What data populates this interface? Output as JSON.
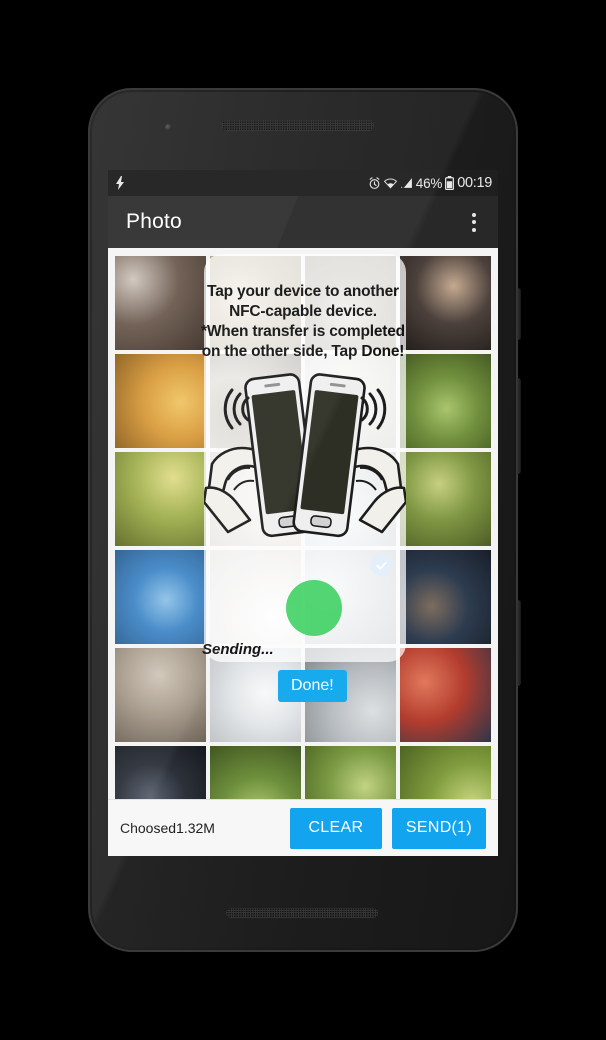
{
  "device": {
    "name": "android-phone-mockup"
  },
  "status_bar": {
    "charging_icon": "bolt-icon",
    "alarm_icon": "alarm-clock-icon",
    "wifi_icon": "wifi-icon",
    "signal_icon": "cellular-signal-icon",
    "battery_icon": "battery-icon",
    "battery_percent": "46%",
    "clock": "00:19"
  },
  "app_bar": {
    "title": "Photo",
    "overflow_icon": "overflow-menu-icon"
  },
  "nfc_overlay": {
    "line1": "Tap your device to another",
    "line2": "NFC-capable device.",
    "line3": "*When transfer is completed",
    "line4": "on the other side, Tap Done!",
    "illustration": "two-phones-tapping-nfc-illustration",
    "done_label": "Done!",
    "sending_label": "Sending...",
    "progress_color": "#2bcd53",
    "done_button_color": "#14a9ec"
  },
  "bottom_bar": {
    "chosen_label": "Choosed1.32M",
    "clear_label": "CLEAR",
    "send_label": "SEND(1)",
    "button_color": "#0fa3ef"
  },
  "grid": {
    "selected_badge_icon": "check-circle-icon",
    "cells": [
      {
        "id": "photo-1",
        "alt": "beard closeup",
        "selected": false
      },
      {
        "id": "photo-2",
        "alt": "ceiling light",
        "selected": false
      },
      {
        "id": "photo-3",
        "alt": "ceiling light 2",
        "selected": false
      },
      {
        "id": "photo-4",
        "alt": "men indoors",
        "selected": false
      },
      {
        "id": "photo-5",
        "alt": "fried pastries",
        "selected": false
      },
      {
        "id": "photo-6",
        "alt": "cat indoors",
        "selected": false
      },
      {
        "id": "photo-7",
        "alt": "blurred room",
        "selected": false
      },
      {
        "id": "photo-8",
        "alt": "green leaves flower",
        "selected": false
      },
      {
        "id": "photo-9",
        "alt": "bee on flower",
        "selected": false
      },
      {
        "id": "photo-10",
        "alt": "indoor blur",
        "selected": false
      },
      {
        "id": "photo-11",
        "alt": "indoor blur 2",
        "selected": false
      },
      {
        "id": "photo-12",
        "alt": "hand with flowers",
        "selected": false
      },
      {
        "id": "photo-13",
        "alt": "tree against sky",
        "selected": false
      },
      {
        "id": "photo-14",
        "alt": "white wall blur",
        "selected": false
      },
      {
        "id": "photo-15",
        "alt": "person portrait",
        "selected": true
      },
      {
        "id": "photo-16",
        "alt": "man in blue jacket",
        "selected": false
      },
      {
        "id": "photo-17",
        "alt": "cat on wall",
        "selected": false
      },
      {
        "id": "photo-18",
        "alt": "bright window blur",
        "selected": false
      },
      {
        "id": "photo-19",
        "alt": "person grey jacket",
        "selected": false
      },
      {
        "id": "photo-20",
        "alt": "man red cap",
        "selected": false
      },
      {
        "id": "photo-21",
        "alt": "black jacket person",
        "selected": false
      },
      {
        "id": "photo-22",
        "alt": "white flowers leaves",
        "selected": false
      },
      {
        "id": "photo-23",
        "alt": "white flowers 2",
        "selected": false
      },
      {
        "id": "photo-24",
        "alt": "citrus tree",
        "selected": false
      }
    ]
  }
}
